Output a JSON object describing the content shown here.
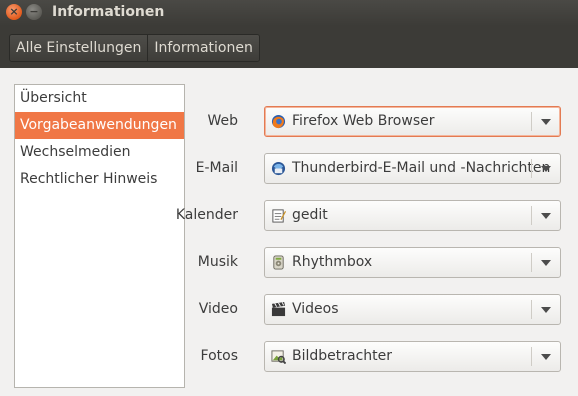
{
  "window": {
    "title": "Informationen",
    "close_symbol": "×",
    "minimize_symbol": "−"
  },
  "toolbar": {
    "breadcrumbs": [
      {
        "label": "Alle Einstellungen"
      },
      {
        "label": "Informationen"
      }
    ]
  },
  "sidebar": {
    "items": [
      {
        "label": "Übersicht",
        "active": false
      },
      {
        "label": "Vorgabeanwendungen",
        "active": true
      },
      {
        "label": "Wechselmedien",
        "active": false
      },
      {
        "label": "Rechtlicher Hinweis",
        "active": false
      }
    ]
  },
  "defaults": [
    {
      "label": "Web",
      "value": "Firefox Web Browser",
      "icon": "firefox-icon"
    },
    {
      "label": "E-Mail",
      "value": "Thunderbird-E-Mail und -Nachrichten",
      "icon": "thunderbird-icon"
    },
    {
      "label": "Kalender",
      "value": "gedit",
      "icon": "gedit-icon"
    },
    {
      "label": "Musik",
      "value": "Rhythmbox",
      "icon": "rhythmbox-icon"
    },
    {
      "label": "Video",
      "value": "Videos",
      "icon": "videos-icon"
    },
    {
      "label": "Fotos",
      "value": "Bildbetrachter",
      "icon": "image-viewer-icon"
    }
  ],
  "colors": {
    "accent": "#f07746",
    "titlebar": "#3c3b37",
    "content_bg": "#f2f1f0"
  }
}
